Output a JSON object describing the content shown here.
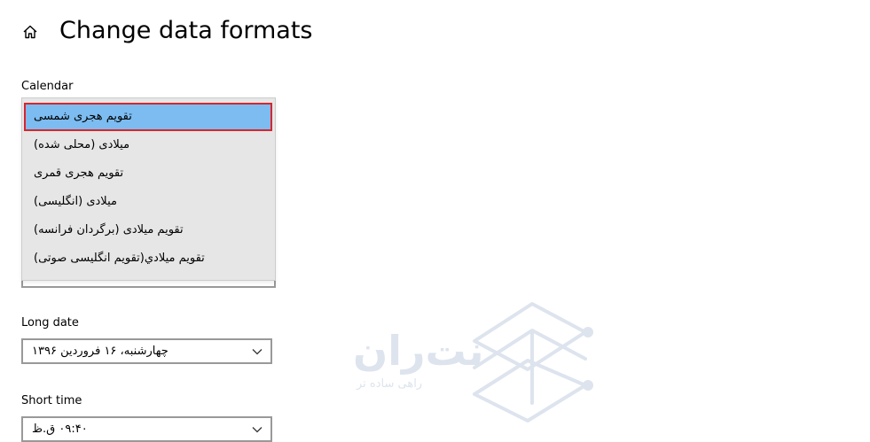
{
  "header": {
    "title": "Change data formats"
  },
  "calendar": {
    "label": "Calendar",
    "options": [
      "تقویم هجری شمسی",
      "میلادی (محلی شده)",
      "تقویم هجری قمری",
      "میلادی (انگلیسی)",
      "تقویم میلادی (برگردان فرانسه)",
      "تقويم ميلادي(تقویم انگلیسی صوتی)"
    ],
    "selected_index": 0
  },
  "long_date": {
    "label": "Long date",
    "value": "چهارشنبه، ۱۶ فروردین ۱۳۹۶"
  },
  "short_time": {
    "label": "Short time",
    "value": "۰۹:۴۰ ق.ظ"
  },
  "watermark": {
    "brand": "نت‌ران",
    "tagline": "راهی ساده تر"
  },
  "colors": {
    "selected_highlight": "#7cbcf0",
    "focus_border": "#d8252c",
    "dropdown_bg": "#e6e6e6",
    "watermark": "#dde4ee"
  },
  "icons": {
    "home": "home-icon",
    "dropdown": "chevron-down-icon",
    "watermark_logo": "netran-logo-icon"
  }
}
